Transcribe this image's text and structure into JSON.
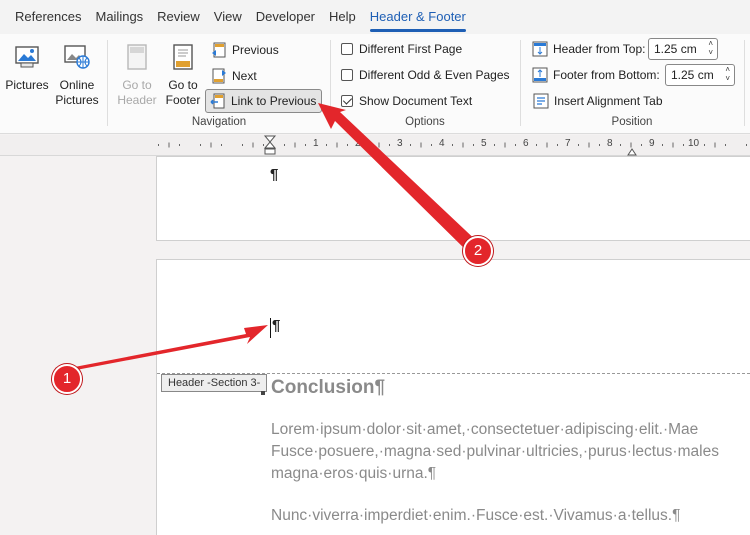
{
  "tabs": [
    "References",
    "Mailings",
    "Review",
    "View",
    "Developer",
    "Help",
    "Header & Footer"
  ],
  "active_tab": "Header & Footer",
  "ribbon": {
    "insert": {
      "pictures": "Pictures",
      "online_pictures_1": "Online",
      "online_pictures_2": "Pictures"
    },
    "navigation": {
      "label": "Navigation",
      "go_to_header_1": "Go to",
      "go_to_header_2": "Header",
      "go_to_footer_1": "Go to",
      "go_to_footer_2": "Footer",
      "previous": "Previous",
      "next": "Next",
      "link_to_previous": "Link to Previous"
    },
    "options": {
      "label": "Options",
      "different_first_page": "Different First Page",
      "different_odd_even": "Different Odd & Even Pages",
      "show_document_text": "Show Document Text"
    },
    "position": {
      "label": "Position",
      "header_from_top_label": "Header from Top:",
      "header_from_top_value": "1.25 cm",
      "footer_from_bottom_label": "Footer from Bottom:",
      "footer_from_bottom_value": "1.25 cm",
      "insert_alignment_tab": "Insert Alignment Tab"
    }
  },
  "ruler": {
    "numbers": [
      "1",
      "2",
      "3",
      "4",
      "5",
      "6",
      "7",
      "8",
      "9",
      "10"
    ]
  },
  "document": {
    "pilcrow": "¶",
    "header_tag": "Header -Section 3-",
    "heading": "Conclusion¶",
    "para1_line1": "Lorem·ipsum·dolor·sit·amet,·consectetuer·adipiscing·elit.·Mae",
    "para1_line2": "Fusce·posuere,·magna·sed·pulvinar·ultricies,·purus·lectus·males",
    "para1_line3": "magna·eros·quis·urna.¶",
    "para2_line1": "Nunc·viverra·imperdiet·enim.·Fusce·est.·Vivamus·a·tellus.¶"
  },
  "annotations": {
    "callout_1": "1",
    "callout_2": "2",
    "arrow_color": "#e3262b"
  },
  "colors": {
    "accent": "#1e5fb5",
    "callout": "#e3262b"
  }
}
